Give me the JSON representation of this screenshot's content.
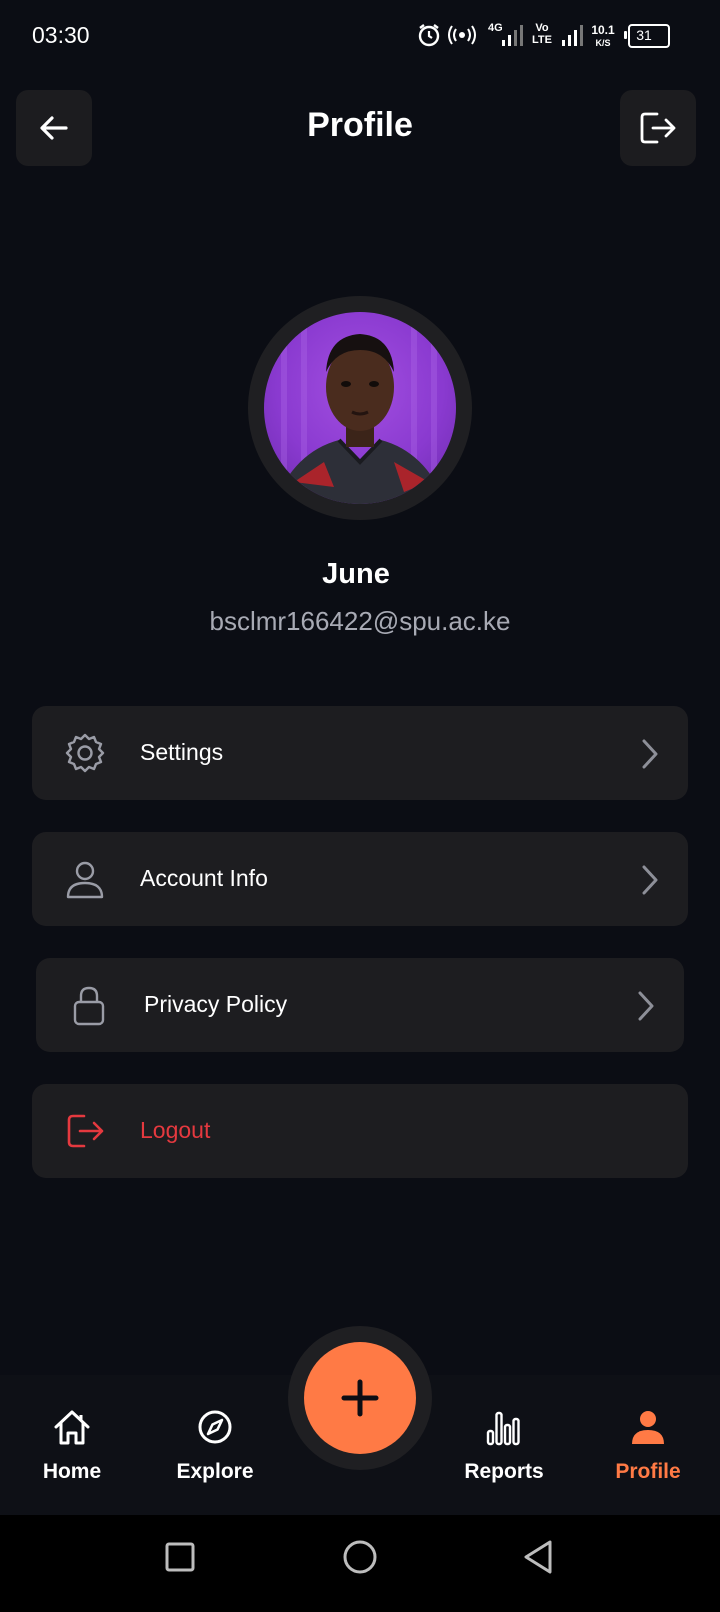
{
  "status_bar": {
    "time": "03:30",
    "network_4g": "4G",
    "volte": "Vo LTE",
    "speed": "10.1",
    "speed_unit": "K/S",
    "battery": "31",
    "icons": [
      "alarm-icon",
      "hotspot-icon",
      "signal-icon",
      "signal-icon",
      "battery-icon"
    ]
  },
  "header": {
    "title": "Profile",
    "back_icon": "arrow-left-icon",
    "logout_icon": "logout-icon"
  },
  "profile": {
    "name": "June",
    "email": "bsclmr166422@spu.ac.ke"
  },
  "menu": {
    "items": [
      {
        "label": "Settings",
        "icon": "gear-icon"
      },
      {
        "label": "Account Info",
        "icon": "user-icon"
      },
      {
        "label": "Privacy Policy",
        "icon": "lock-icon"
      },
      {
        "label": "Logout",
        "icon": "logout-icon"
      }
    ]
  },
  "bottom_nav": {
    "items": [
      {
        "label": "Home",
        "icon": "home-icon"
      },
      {
        "label": "Explore",
        "icon": "compass-icon"
      },
      {
        "label": "Reports",
        "icon": "bar-chart-icon"
      },
      {
        "label": "Profile",
        "icon": "person-icon"
      }
    ],
    "active": "Profile",
    "fab_icon": "plus-icon"
  },
  "colors": {
    "background": "#0b0d14",
    "card": "#1d1d20",
    "accent": "#ff7a45",
    "danger": "#e5393f",
    "muted_text": "#a8aab4"
  }
}
